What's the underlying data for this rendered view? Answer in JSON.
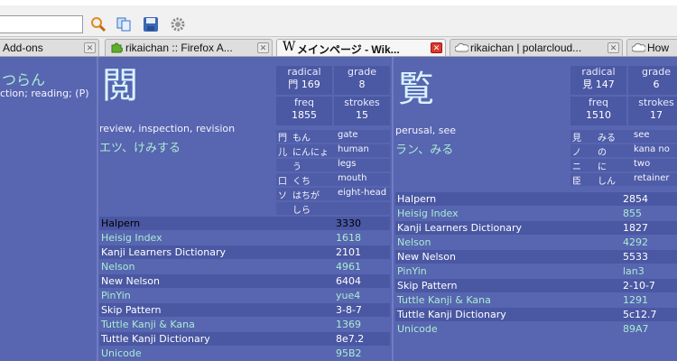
{
  "tabs": [
    {
      "label": "Add-ons",
      "favicon": "puzzle-icon"
    },
    {
      "label": "rikaichan :: Firefox A...",
      "favicon": "puzzle-icon"
    },
    {
      "label": "メインページ - Wik...",
      "favicon": "wikipedia-icon"
    },
    {
      "label": "rikaichan | polarcloud...",
      "favicon": "cloud-icon"
    },
    {
      "label": "How",
      "favicon": "cloud-icon"
    }
  ],
  "left_partial": {
    "reading": "つらん",
    "meaning": "ction; reading; (P)"
  },
  "kanji1": {
    "char": "閲",
    "meaning": "review, inspection, revision",
    "reading": "エツ、けみする",
    "radical_label": "radical",
    "radical_value": "門 169",
    "grade_label": "grade",
    "grade_value": "8",
    "freq_label": "freq",
    "freq_value": "1855",
    "strokes_label": "strokes",
    "strokes_value": "15",
    "parts": [
      {
        "k": "門",
        "r": "もん",
        "m": "gate"
      },
      {
        "k": "儿",
        "r": "にんにょ",
        "m": "human"
      },
      {
        "k": "",
        "r": "う",
        "m": "legs"
      },
      {
        "k": "口",
        "r": "くち",
        "m": "mouth"
      },
      {
        "k": "ソ",
        "r": "はちが",
        "m": "eight-head"
      },
      {
        "k": "",
        "r": "しら",
        "m": ""
      }
    ],
    "dicts": [
      {
        "name": "Halpern",
        "value": "3330"
      },
      {
        "name": "Heisig Index",
        "value": "1618"
      },
      {
        "name": "Kanji Learners Dictionary",
        "value": "2101"
      },
      {
        "name": "Nelson",
        "value": "4961"
      },
      {
        "name": "New Nelson",
        "value": "6404"
      },
      {
        "name": "PinYin",
        "value": "yue4"
      },
      {
        "name": "Skip Pattern",
        "value": "3-8-7"
      },
      {
        "name": "Tuttle Kanji & Kana",
        "value": "1369"
      },
      {
        "name": "Tuttle Kanji Dictionary",
        "value": "8e7.2"
      },
      {
        "name": "Unicode",
        "value": "95B2"
      }
    ]
  },
  "kanji2": {
    "char": "覧",
    "meaning": "perusal, see",
    "reading": "ラン、みる",
    "radical_label": "radical",
    "radical_value": "見 147",
    "grade_label": "grade",
    "grade_value": "6",
    "freq_label": "freq",
    "freq_value": "1510",
    "strokes_label": "strokes",
    "strokes_value": "17",
    "parts": [
      {
        "k": "見",
        "r": "みる",
        "m": "see"
      },
      {
        "k": "ノ",
        "r": "の",
        "m": "kana no"
      },
      {
        "k": "ニ",
        "r": "に",
        "m": "two"
      },
      {
        "k": "臣",
        "r": "しん",
        "m": "retainer"
      }
    ],
    "dicts": [
      {
        "name": "Halpern",
        "value": "2854"
      },
      {
        "name": "Heisig Index",
        "value": "855"
      },
      {
        "name": "Kanji Learners Dictionary",
        "value": "1827"
      },
      {
        "name": "Nelson",
        "value": "4292"
      },
      {
        "name": "New Nelson",
        "value": "5533"
      },
      {
        "name": "PinYin",
        "value": "lan3"
      },
      {
        "name": "Skip Pattern",
        "value": "2-10-7"
      },
      {
        "name": "Tuttle Kanji & Kana",
        "value": "1291"
      },
      {
        "name": "Tuttle Kanji Dictionary",
        "value": "5c12.7"
      },
      {
        "name": "Unicode",
        "value": "89A7"
      }
    ]
  },
  "colors": {
    "popup_bg": "#5865b0",
    "green_text": "#a9ecd2",
    "kanji": "#d7f3ff"
  }
}
